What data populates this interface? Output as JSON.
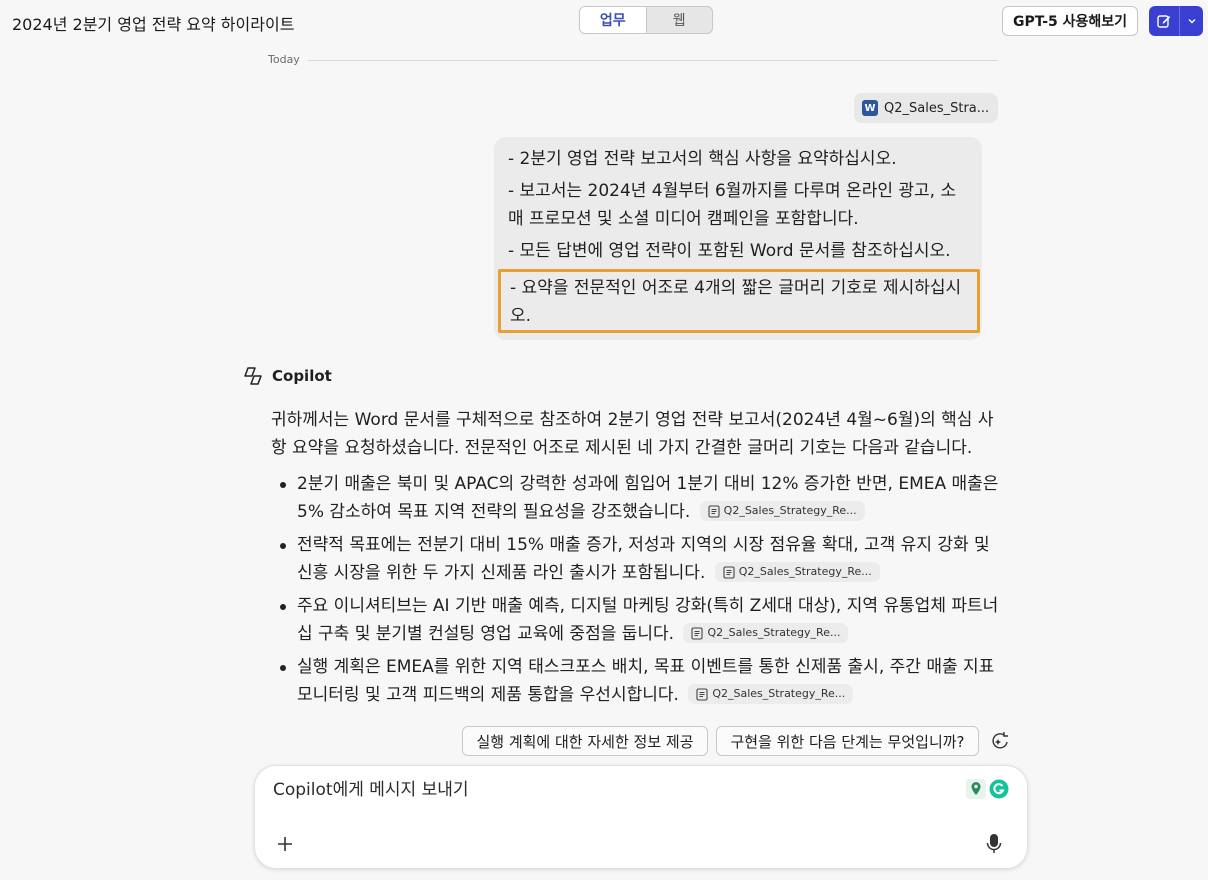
{
  "header": {
    "title": "2024년 2분기 영업 전략 요약 하이라이트",
    "mode_tabs": [
      {
        "label": "업무",
        "active": true
      },
      {
        "label": "웹",
        "active": false
      }
    ],
    "gpt_button": "GPT-5 사용해보기",
    "accent_color": "#3b3fd1"
  },
  "conversation": {
    "date_divider": "Today",
    "attached_file": "Q2_Sales_Stra...",
    "user_message": [
      "- 2분기 영업 전략 보고서의 핵심 사항을 요약하십시오.",
      "- 보고서는 2024년 4월부터 6월까지를 다루며 온라인 광고, 소매 프로모션 및 소셜 미디어 캠페인을 포함합니다.",
      "- 모든 답변에 영업 전략이 포함된 Word 문서를 참조하십시오.",
      "- 요약을 전문적인 어조로 4개의 짧은 글머리 기호로 제시하십시오."
    ],
    "highlight_color": "#e8a033",
    "assistant_name": "Copilot",
    "assistant_intro": "귀하께서는 Word 문서를 구체적으로 참조하여 2분기 영업 전략 보고서(2024년 4월~6월)의 핵심 사항 요약을 요청하셨습니다. 전문적인 어조로 제시된 네 가지 간결한 글머리 기호는 다음과 같습니다.",
    "bullets": [
      {
        "text": "2분기 매출은 북미 및 APAC의 강력한 성과에 힘입어 1분기 대비 12% 증가한 반면, EMEA 매출은 5% 감소하여 목표 지역 전략의 필요성을 강조했습니다.",
        "citation": "Q2_Sales_Strategy_Re..."
      },
      {
        "text": "전략적 목표에는 전분기 대비 15% 매출 증가, 저성과 지역의 시장 점유율 확대, 고객 유지 강화 및 신흥 시장을 위한 두 가지 신제품 라인 출시가 포함됩니다.",
        "citation": "Q2_Sales_Strategy_Re..."
      },
      {
        "text": "주요 이니셔티브는 AI 기반 매출 예측, 디지털 마케팅 강화(특히 Z세대 대상), 지역 유통업체 파트너십 구축 및 분기별 컨설팅 영업 교육에 중점을 둡니다.",
        "citation": "Q2_Sales_Strategy_Re..."
      },
      {
        "text": "실행 계획은 EMEA를 위한 지역 태스크포스 배치, 목표 이벤트를 통한 신제품 출시, 주간 매출 지표 모니터링 및 고객 피드백의 제품 통합을 우선시합니다.",
        "citation": "Q2_Sales_Strategy_Re..."
      }
    ],
    "suggestions": [
      "실행 계획에 대한 자세한 정보 제공",
      "구현을 위한 다음 단계는 무엇입니까?"
    ]
  },
  "composer": {
    "placeholder": "Copilot에게 메시지 보내기"
  },
  "icons": {
    "new_chat": "compose-icon",
    "dropdown": "chevron-down-icon",
    "copilot": "copilot-logo-icon",
    "attach": "plus-icon",
    "mic": "microphone-icon",
    "refresh": "sparkle-refresh-icon"
  }
}
